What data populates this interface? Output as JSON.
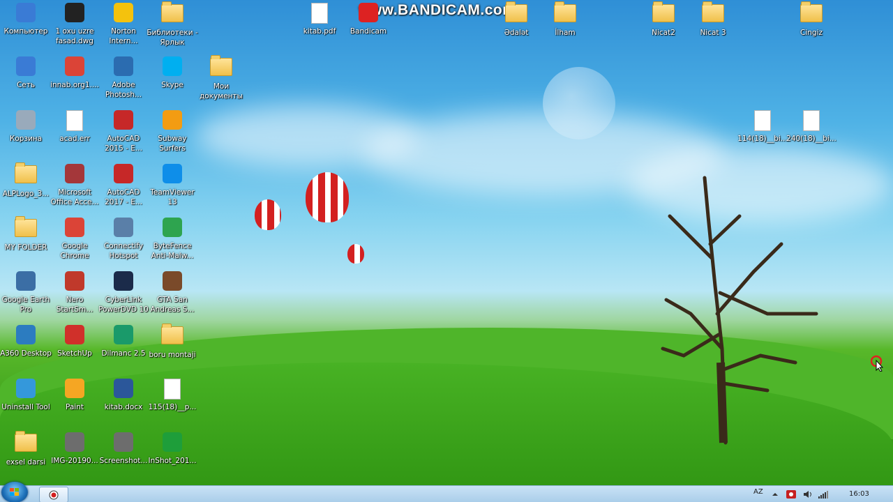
{
  "watermark": "www.BANDICAM.com",
  "desktop_icons": [
    {
      "label": "Компьютер",
      "icon": "computer-icon"
    },
    {
      "label": "1 oxu uzre fasad.dwg",
      "icon": "dwg-file-icon"
    },
    {
      "label": "Norton Intern...",
      "icon": "norton-icon"
    },
    {
      "label": "Библиотеки - Ярлык",
      "icon": "libraries-icon"
    },
    {
      "label": "kitab.pdf",
      "icon": "pdf-file-icon"
    },
    {
      "label": "Bandicam",
      "icon": "bandicam-icon"
    },
    {
      "label": "Ədalət",
      "icon": "folder-icon"
    },
    {
      "label": "İlham",
      "icon": "folder-icon"
    },
    {
      "label": "Nicat2",
      "icon": "folder-icon"
    },
    {
      "label": "Nicat 3",
      "icon": "folder-icon"
    },
    {
      "label": "Cingiz",
      "icon": "folder-icon"
    },
    {
      "label": "Сеть",
      "icon": "network-icon"
    },
    {
      "label": "innab.org1....",
      "icon": "chrome-icon"
    },
    {
      "label": "Adobe Photosh...",
      "icon": "photoshop-icon"
    },
    {
      "label": "Skype",
      "icon": "skype-icon"
    },
    {
      "label": "Мои документы",
      "icon": "folder-icon"
    },
    {
      "label": "Корзина",
      "icon": "recycle-bin-icon"
    },
    {
      "label": "acad.err",
      "icon": "file-icon"
    },
    {
      "label": "AutoCAD 2015 - E...",
      "icon": "autocad-icon"
    },
    {
      "label": "Subway Surfers",
      "icon": "subway-surfers-icon"
    },
    {
      "label": "114(18)__bi...",
      "icon": "file-icon"
    },
    {
      "label": "240(18)__bi...",
      "icon": "file-icon"
    },
    {
      "label": "ALPLogo_3...",
      "icon": "folder-icon"
    },
    {
      "label": "Microsoft Office Acce...",
      "icon": "access-icon"
    },
    {
      "label": "AutoCAD 2017 - E...",
      "icon": "autocad-icon"
    },
    {
      "label": "TeamViewer 13",
      "icon": "teamviewer-icon"
    },
    {
      "label": "MY FOLDER",
      "icon": "folder-icon"
    },
    {
      "label": "Google Chrome",
      "icon": "chrome-icon"
    },
    {
      "label": "Connectify Hotspot",
      "icon": "connectify-icon"
    },
    {
      "label": "ByteFence Anti-Malw...",
      "icon": "bytefence-icon"
    },
    {
      "label": "Google Earth Pro",
      "icon": "google-earth-icon"
    },
    {
      "label": "Nero StartSm...",
      "icon": "nero-icon"
    },
    {
      "label": "CyberLink PowerDVD 10",
      "icon": "powerdvd-icon"
    },
    {
      "label": "GTA San Andreas S...",
      "icon": "gta-icon"
    },
    {
      "label": "A360 Desktop",
      "icon": "a360-icon"
    },
    {
      "label": "SketchUp",
      "icon": "sketchup-icon"
    },
    {
      "label": "Dilmanc 2.5",
      "icon": "dilmanc-icon"
    },
    {
      "label": "boru montaji",
      "icon": "folder-icon"
    },
    {
      "label": "Uninstall Tool",
      "icon": "uninstall-tool-icon"
    },
    {
      "label": "Paint",
      "icon": "paint-icon"
    },
    {
      "label": "kitab.docx",
      "icon": "word-doc-icon"
    },
    {
      "label": "115(18)__p...",
      "icon": "file-icon"
    },
    {
      "label": "exsel darsi",
      "icon": "folder-icon"
    },
    {
      "label": "IMG-20190...",
      "icon": "image-file-icon"
    },
    {
      "label": "Screenshot...",
      "icon": "image-file-icon"
    },
    {
      "label": "InShot_201...",
      "icon": "inshot-icon"
    }
  ],
  "taskbar": {
    "language": "AZ",
    "clock": "16:03"
  },
  "colors": {
    "taskbar": "#b9d6ee",
    "sky": "#4fb2e6",
    "grass": "#3ea11c"
  }
}
